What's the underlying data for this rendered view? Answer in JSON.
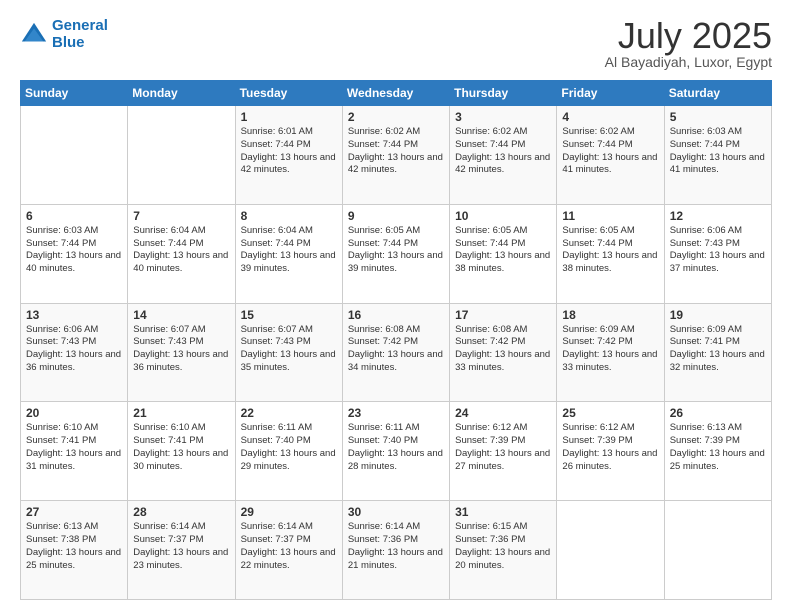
{
  "header": {
    "logo_line1": "General",
    "logo_line2": "Blue",
    "month": "July 2025",
    "location": "Al Bayadiyah, Luxor, Egypt"
  },
  "days_of_week": [
    "Sunday",
    "Monday",
    "Tuesday",
    "Wednesday",
    "Thursday",
    "Friday",
    "Saturday"
  ],
  "weeks": [
    [
      {
        "day": "",
        "detail": ""
      },
      {
        "day": "",
        "detail": ""
      },
      {
        "day": "1",
        "detail": "Sunrise: 6:01 AM\nSunset: 7:44 PM\nDaylight: 13 hours and 42 minutes."
      },
      {
        "day": "2",
        "detail": "Sunrise: 6:02 AM\nSunset: 7:44 PM\nDaylight: 13 hours and 42 minutes."
      },
      {
        "day": "3",
        "detail": "Sunrise: 6:02 AM\nSunset: 7:44 PM\nDaylight: 13 hours and 42 minutes."
      },
      {
        "day": "4",
        "detail": "Sunrise: 6:02 AM\nSunset: 7:44 PM\nDaylight: 13 hours and 41 minutes."
      },
      {
        "day": "5",
        "detail": "Sunrise: 6:03 AM\nSunset: 7:44 PM\nDaylight: 13 hours and 41 minutes."
      }
    ],
    [
      {
        "day": "6",
        "detail": "Sunrise: 6:03 AM\nSunset: 7:44 PM\nDaylight: 13 hours and 40 minutes."
      },
      {
        "day": "7",
        "detail": "Sunrise: 6:04 AM\nSunset: 7:44 PM\nDaylight: 13 hours and 40 minutes."
      },
      {
        "day": "8",
        "detail": "Sunrise: 6:04 AM\nSunset: 7:44 PM\nDaylight: 13 hours and 39 minutes."
      },
      {
        "day": "9",
        "detail": "Sunrise: 6:05 AM\nSunset: 7:44 PM\nDaylight: 13 hours and 39 minutes."
      },
      {
        "day": "10",
        "detail": "Sunrise: 6:05 AM\nSunset: 7:44 PM\nDaylight: 13 hours and 38 minutes."
      },
      {
        "day": "11",
        "detail": "Sunrise: 6:05 AM\nSunset: 7:44 PM\nDaylight: 13 hours and 38 minutes."
      },
      {
        "day": "12",
        "detail": "Sunrise: 6:06 AM\nSunset: 7:43 PM\nDaylight: 13 hours and 37 minutes."
      }
    ],
    [
      {
        "day": "13",
        "detail": "Sunrise: 6:06 AM\nSunset: 7:43 PM\nDaylight: 13 hours and 36 minutes."
      },
      {
        "day": "14",
        "detail": "Sunrise: 6:07 AM\nSunset: 7:43 PM\nDaylight: 13 hours and 36 minutes."
      },
      {
        "day": "15",
        "detail": "Sunrise: 6:07 AM\nSunset: 7:43 PM\nDaylight: 13 hours and 35 minutes."
      },
      {
        "day": "16",
        "detail": "Sunrise: 6:08 AM\nSunset: 7:42 PM\nDaylight: 13 hours and 34 minutes."
      },
      {
        "day": "17",
        "detail": "Sunrise: 6:08 AM\nSunset: 7:42 PM\nDaylight: 13 hours and 33 minutes."
      },
      {
        "day": "18",
        "detail": "Sunrise: 6:09 AM\nSunset: 7:42 PM\nDaylight: 13 hours and 33 minutes."
      },
      {
        "day": "19",
        "detail": "Sunrise: 6:09 AM\nSunset: 7:41 PM\nDaylight: 13 hours and 32 minutes."
      }
    ],
    [
      {
        "day": "20",
        "detail": "Sunrise: 6:10 AM\nSunset: 7:41 PM\nDaylight: 13 hours and 31 minutes."
      },
      {
        "day": "21",
        "detail": "Sunrise: 6:10 AM\nSunset: 7:41 PM\nDaylight: 13 hours and 30 minutes."
      },
      {
        "day": "22",
        "detail": "Sunrise: 6:11 AM\nSunset: 7:40 PM\nDaylight: 13 hours and 29 minutes."
      },
      {
        "day": "23",
        "detail": "Sunrise: 6:11 AM\nSunset: 7:40 PM\nDaylight: 13 hours and 28 minutes."
      },
      {
        "day": "24",
        "detail": "Sunrise: 6:12 AM\nSunset: 7:39 PM\nDaylight: 13 hours and 27 minutes."
      },
      {
        "day": "25",
        "detail": "Sunrise: 6:12 AM\nSunset: 7:39 PM\nDaylight: 13 hours and 26 minutes."
      },
      {
        "day": "26",
        "detail": "Sunrise: 6:13 AM\nSunset: 7:39 PM\nDaylight: 13 hours and 25 minutes."
      }
    ],
    [
      {
        "day": "27",
        "detail": "Sunrise: 6:13 AM\nSunset: 7:38 PM\nDaylight: 13 hours and 25 minutes."
      },
      {
        "day": "28",
        "detail": "Sunrise: 6:14 AM\nSunset: 7:37 PM\nDaylight: 13 hours and 23 minutes."
      },
      {
        "day": "29",
        "detail": "Sunrise: 6:14 AM\nSunset: 7:37 PM\nDaylight: 13 hours and 22 minutes."
      },
      {
        "day": "30",
        "detail": "Sunrise: 6:14 AM\nSunset: 7:36 PM\nDaylight: 13 hours and 21 minutes."
      },
      {
        "day": "31",
        "detail": "Sunrise: 6:15 AM\nSunset: 7:36 PM\nDaylight: 13 hours and 20 minutes."
      },
      {
        "day": "",
        "detail": ""
      },
      {
        "day": "",
        "detail": ""
      }
    ]
  ]
}
